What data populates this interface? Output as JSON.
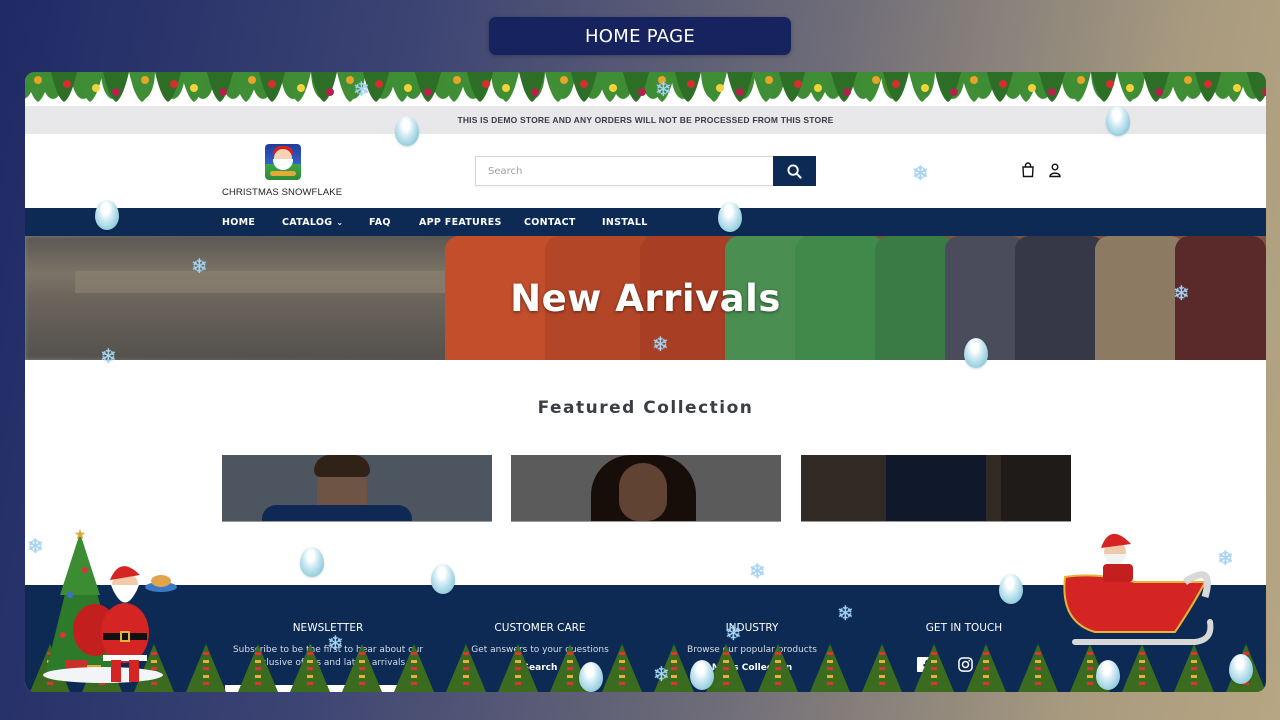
{
  "page_label": "HOME PAGE",
  "announcement": "THIS IS DEMO STORE AND ANY ORDERS WILL NOT BE PROCESSED FROM THIS STORE",
  "header": {
    "logo_text": "CHRISTMAS SNOWFLAKE",
    "search_placeholder": "Search",
    "search_value": "",
    "icons": [
      "search-icon",
      "cart-icon",
      "account-icon"
    ]
  },
  "nav": {
    "items": [
      {
        "label": "HOME"
      },
      {
        "label": "CATALOG",
        "has_dropdown": true,
        "chevron": "⌄"
      },
      {
        "label": "FAQ"
      },
      {
        "label": "APP FEATURES"
      },
      {
        "label": "CONTACT"
      },
      {
        "label": "INSTALL"
      }
    ]
  },
  "hero": {
    "title": "New Arrivals"
  },
  "featured": {
    "title": "Featured Collection",
    "cards": [
      {
        "subject": "man-in-blue-jacket"
      },
      {
        "subject": "woman-with-curly-hair"
      },
      {
        "subject": "jeans-closeup"
      }
    ]
  },
  "footer": {
    "columns": [
      {
        "heading": "NEWSLETTER",
        "text": "Subscribe to be the first to hear about our exclusive offers and latest arrivals",
        "link": ""
      },
      {
        "heading": "CUSTOMER CARE",
        "text": "Get answers to your questions",
        "link": "Search"
      },
      {
        "heading": "INDUSTRY",
        "text": "Browse our popular products",
        "link": "Mens Collection"
      },
      {
        "heading": "GET IN TOUCH",
        "text": "",
        "link": ""
      }
    ],
    "social": [
      "facebook-icon",
      "instagram-icon"
    ]
  },
  "decorations": {
    "snowflake_glyph": "❄",
    "colors": {
      "nav": "#0d2a54",
      "label_bg": "#17235e",
      "announce_bg": "#e8e8ea",
      "snowflake": "#a9d4f2"
    }
  }
}
